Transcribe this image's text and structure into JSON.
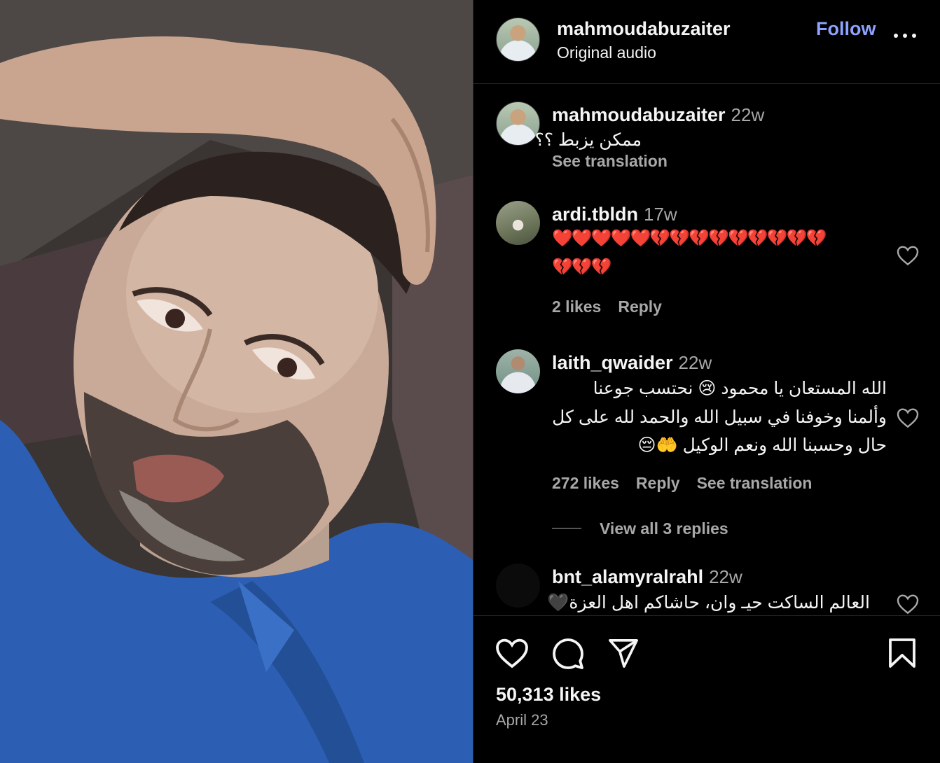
{
  "post": {
    "username": "mahmoudabuzaiter",
    "audio": "Original audio",
    "follow_label": "Follow",
    "likes": "50,313 likes",
    "date": "April 23"
  },
  "comments": [
    {
      "username": "mahmoudabuzaiter",
      "time": "22w",
      "text": "ممكن يزبط ؟؟",
      "see_translation": "See translation"
    },
    {
      "username": "ardi.tbldn",
      "time": "17w",
      "text_line1": "❤️❤️❤️❤️❤️💔💔💔💔💔💔💔💔💔",
      "text_line2": "💔💔💔",
      "likes": "2 likes",
      "reply": "Reply"
    },
    {
      "username": "laith_qwaider",
      "time": "22w",
      "text_line1": "الله المستعان يا محمود 😢 نحتسب جوعنا",
      "text_line2": "وألمنا وخوفنا في سبيل الله والحمد لله على كل",
      "text_line3": "حال وحسبنا الله ونعم الوكيل 🤲😔",
      "likes": "272 likes",
      "reply": "Reply",
      "see_translation": "See translation",
      "view_replies": "View all 3 replies"
    },
    {
      "username": "bnt_alamyralrahl",
      "time": "22w",
      "text": "العالم الساكت حيـ وان، حاشاكم اهل العزة🖤"
    }
  ],
  "icons": {
    "like": "heart-icon",
    "comment": "comment-icon",
    "share": "share-icon",
    "save": "bookmark-icon",
    "more": "more-icon",
    "comment_like": "heart-icon"
  },
  "colors": {
    "background": "#000000",
    "link_blue": "#8ea2ff",
    "secondary_text": "#a8a8a8",
    "border": "#262626"
  }
}
